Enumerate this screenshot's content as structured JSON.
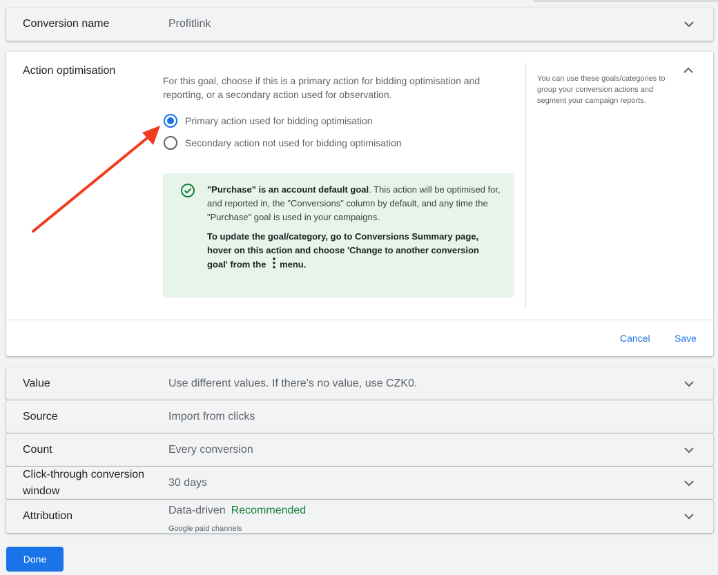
{
  "rows": {
    "conversion_name": {
      "label": "Conversion name",
      "value": "Profitlink"
    },
    "value": {
      "label": "Value",
      "value": "Use different values. If there's no value, use CZK0."
    },
    "source": {
      "label": "Source",
      "value": "Import from clicks"
    },
    "count": {
      "label": "Count",
      "value": "Every conversion"
    },
    "click_through": {
      "label_line1": "Click-through conversion",
      "label_line2": "window",
      "value": "30 days"
    },
    "attribution": {
      "label": "Attribution",
      "value": "Data-driven",
      "badge": "Recommended",
      "subtext": "Google paid channels"
    }
  },
  "action_optimisation": {
    "label": "Action optimisation",
    "description": "For this goal, choose if this is a primary action for bidding optimisation and reporting, or a secondary action used for observation.",
    "options": [
      {
        "label": "Primary action used for bidding optimisation",
        "selected": true
      },
      {
        "label": "Secondary action not used for bidding optimisation",
        "selected": false
      }
    ],
    "notice": {
      "bold_lead": "\"Purchase\" is an account default goal",
      "body": ". This action will be optimised for, and reported in, the \"Conversions\" column by default, and any time the \"Purchase\" goal is used in your campaigns.",
      "para2_before": "To update the goal/category, go to Conversions Summary page, hover on this action and choose 'Change to another conversion goal' from the",
      "para2_after": "menu."
    },
    "help": "You can use these goals/categories to group your conversion actions and segment your campaign reports.",
    "cancel_label": "Cancel",
    "save_label": "Save"
  },
  "done_label": "Done",
  "colors": {
    "accent": "#1a73e8",
    "success": "#188038",
    "notice_bg": "#e6f4ea",
    "annotation_arrow": "#f23a1d"
  },
  "icons": [
    "chevron-down-icon",
    "chevron-up-icon",
    "check-circle-icon",
    "more-vert-icon"
  ]
}
